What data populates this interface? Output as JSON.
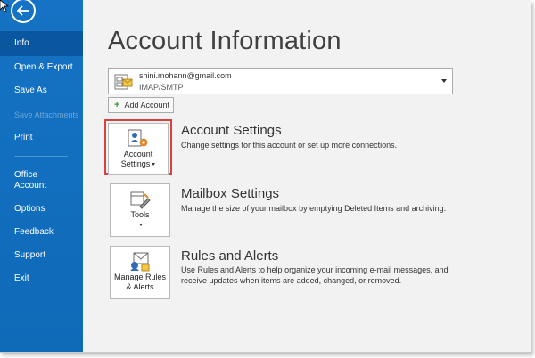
{
  "sidebar": {
    "items": [
      {
        "label": "Info",
        "active": true
      },
      {
        "label": "Open & Export"
      },
      {
        "label": "Save As"
      },
      {
        "label": "Save Attachments",
        "disabled": true
      },
      {
        "label": "Print"
      },
      {
        "label": "Office",
        "label2": "Account"
      },
      {
        "label": "Options"
      },
      {
        "label": "Feedback"
      },
      {
        "label": "Support"
      },
      {
        "label": "Exit"
      }
    ]
  },
  "main": {
    "title": "Account Information",
    "account": {
      "email": "shini.mohann@gmail.com",
      "type": "IMAP/SMTP"
    },
    "add_account_label": "Add Account",
    "sections": [
      {
        "button_line1": "Account",
        "button_line2": "Settings",
        "title": "Account Settings",
        "description": "Change settings for this account or set up more connections."
      },
      {
        "button_line1": "Tools",
        "title": "Mailbox Settings",
        "description": "Manage the size of your mailbox by emptying Deleted Items and archiving."
      },
      {
        "button_line1": "Manage Rules",
        "button_line2": "& Alerts",
        "title": "Rules and Alerts",
        "description": "Use Rules and Alerts to help organize your incoming e-mail messages, and receive updates when items are added, changed, or removed."
      }
    ]
  },
  "colors": {
    "sidebar": "#106ebe",
    "highlight": "#d9413f",
    "background": "#f2f2f2"
  }
}
